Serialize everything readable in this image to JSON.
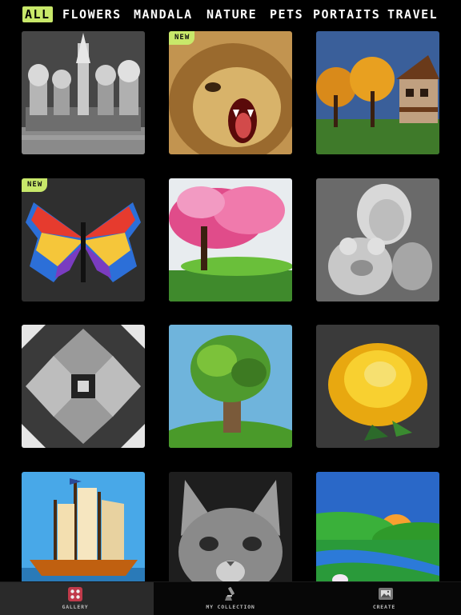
{
  "tabs": [
    {
      "label": "ALL",
      "active": true
    },
    {
      "label": "FLOWERS",
      "active": false
    },
    {
      "label": "MANDALA",
      "active": false
    },
    {
      "label": "NATURE",
      "active": false
    },
    {
      "label": "PETS",
      "active": false
    },
    {
      "label": "PORTAITS",
      "active": false
    },
    {
      "label": "TRAVEL",
      "active": false
    }
  ],
  "gallery": {
    "items": [
      {
        "icon": "cathedral-picture",
        "badge": ""
      },
      {
        "icon": "lion-picture",
        "badge": "NEW"
      },
      {
        "icon": "autumn-house-picture",
        "badge": ""
      },
      {
        "icon": "rainbow-butterfly-picture",
        "badge": "NEW"
      },
      {
        "icon": "cherry-blossom-tree-picture",
        "badge": ""
      },
      {
        "icon": "girl-with-teddy-bear-picture",
        "badge": ""
      },
      {
        "icon": "geometric-mandala-picture",
        "badge": ""
      },
      {
        "icon": "green-tree-picture",
        "badge": ""
      },
      {
        "icon": "yellow-rose-picture",
        "badge": ""
      },
      {
        "icon": "sailing-ship-picture",
        "badge": ""
      },
      {
        "icon": "kitten-picture",
        "badge": ""
      },
      {
        "icon": "unicorn-landscape-picture",
        "badge": ""
      }
    ]
  },
  "nav": {
    "gallery_label": "GALLERY",
    "collection_label": "MY COLLECTION",
    "create_label": "CREATE",
    "gallery_icon": "gallery-grid-icon",
    "collection_icon": "paint-brush-icon",
    "create_icon": "picture-frame-icon"
  },
  "colors": {
    "accent": "#c8e86a",
    "background": "#000000"
  }
}
